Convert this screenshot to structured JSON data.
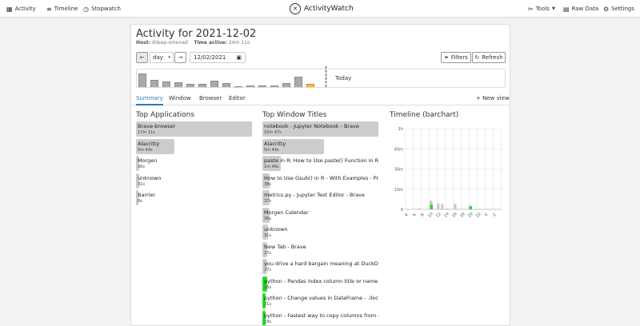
{
  "nav": {
    "activity": "Activity",
    "timeline": "Timeline",
    "stopwatch": "Stopwatch",
    "brand": "ActivityWatch",
    "tools": "Tools",
    "raw_data": "Raw Data",
    "settings": "Settings"
  },
  "header": {
    "title": "Activity for 2021-12-02",
    "host_label": "Host:",
    "host_value": "dileep-xmonad",
    "active_label": "Time active:",
    "active_value": "24m 11s"
  },
  "controls": {
    "period": "day",
    "date": "12/02/2021",
    "filters": "Filters",
    "refresh": "Refresh"
  },
  "mini_timeline": {
    "today_label": "Today",
    "levels": [
      0.85,
      0.45,
      0.35,
      0.3,
      0.2,
      0.2,
      0.38,
      0.25,
      0.05,
      0.1,
      0.1,
      0.12,
      0.25,
      0.65,
      0.2
    ]
  },
  "tabs": [
    "Summary",
    "Window",
    "Browser",
    "Editor"
  ],
  "new_view": "New view",
  "top_apps": {
    "title": "Top Applications",
    "items": [
      {
        "name": "Brave-browser",
        "time": "17m 11s",
        "frac": 1.0,
        "color": "#cccccc"
      },
      {
        "name": "Alacritty",
        "time": "5m 44s",
        "frac": 0.33,
        "color": "#cccccc"
      },
      {
        "name": "Morgen",
        "time": "36s",
        "frac": 0.03,
        "color": "#cccccc"
      },
      {
        "name": "unknown",
        "time": "31s",
        "frac": 0.03,
        "color": "#cccccc"
      },
      {
        "name": "Barrier",
        "time": "8s",
        "frac": 0.01,
        "color": "#cccccc"
      }
    ]
  },
  "top_titles": {
    "title": "Top Window Titles",
    "items": [
      {
        "name": "notebook - Jupyter Notebook - Brave",
        "time": "10m 47s",
        "frac": 1.0,
        "color": "#cccccc"
      },
      {
        "name": "Alacritty",
        "time": "5m 44s",
        "frac": 0.53,
        "color": "#cccccc"
      },
      {
        "name": "paste in R: How to Use paste() Function in R - Br...",
        "time": "1m 46s",
        "frac": 0.16,
        "color": "#cccccc"
      },
      {
        "name": "How to Use Gsub() in R - With Examples - Progra...",
        "time": "38s",
        "frac": 0.06,
        "color": "#cccccc"
      },
      {
        "name": "metrics.py - Jupyter Text Editor - Brave",
        "time": "37s",
        "frac": 0.06,
        "color": "#cccccc"
      },
      {
        "name": "Morgen Calendar",
        "time": "36s",
        "frac": 0.06,
        "color": "#cccccc"
      },
      {
        "name": "unknown",
        "time": "31s",
        "frac": 0.05,
        "color": "#cccccc"
      },
      {
        "name": "New Tab - Brave",
        "time": "27s",
        "frac": 0.04,
        "color": "#cccccc"
      },
      {
        "name": "you drive a hard bargain meaning at DuckDuckG...",
        "time": "27s",
        "frac": 0.04,
        "color": "#cccccc"
      },
      {
        "name": "python - Pandas index column title or name - Sta...",
        "time": "26s",
        "frac": 0.04,
        "color": "#22dd22"
      },
      {
        "name": "python - Change values in DataFrame - .iloc vs .l...",
        "time": "21s",
        "frac": 0.03,
        "color": "#22dd22"
      },
      {
        "name": "python - Fastest way to copy columns from one D...",
        "time": "18s",
        "frac": 0.03,
        "color": "#22dd22"
      }
    ]
  },
  "chart_data": {
    "type": "bar",
    "title": "Timeline (barchart)",
    "y_ticks": [
      "1h",
      "45m",
      "30m",
      "15m",
      "0"
    ],
    "ylim": [
      0,
      60
    ],
    "categories": [
      "4",
      "6",
      "8",
      "10",
      "12",
      "14",
      "16",
      "18",
      "20",
      "22",
      "0",
      "2"
    ],
    "bars": [
      {
        "cat_index": 1.5,
        "value": 0.8,
        "color": "#cccccc"
      },
      {
        "cat_index": 3.0,
        "value": 6.5,
        "color": "#cccccc"
      },
      {
        "cat_index": 3.05,
        "value": 3.5,
        "color": "#22dd22"
      },
      {
        "cat_index": 3.9,
        "value": 4.3,
        "color": "#cccccc"
      },
      {
        "cat_index": 4.4,
        "value": 3.8,
        "color": "#cccccc"
      },
      {
        "cat_index": 5.0,
        "value": 0.6,
        "color": "#cccccc"
      },
      {
        "cat_index": 6.0,
        "value": 4.0,
        "color": "#cccccc"
      },
      {
        "cat_index": 7.9,
        "value": 3.0,
        "color": "#cccccc"
      },
      {
        "cat_index": 7.95,
        "value": 2.2,
        "color": "#22dd22"
      }
    ]
  }
}
